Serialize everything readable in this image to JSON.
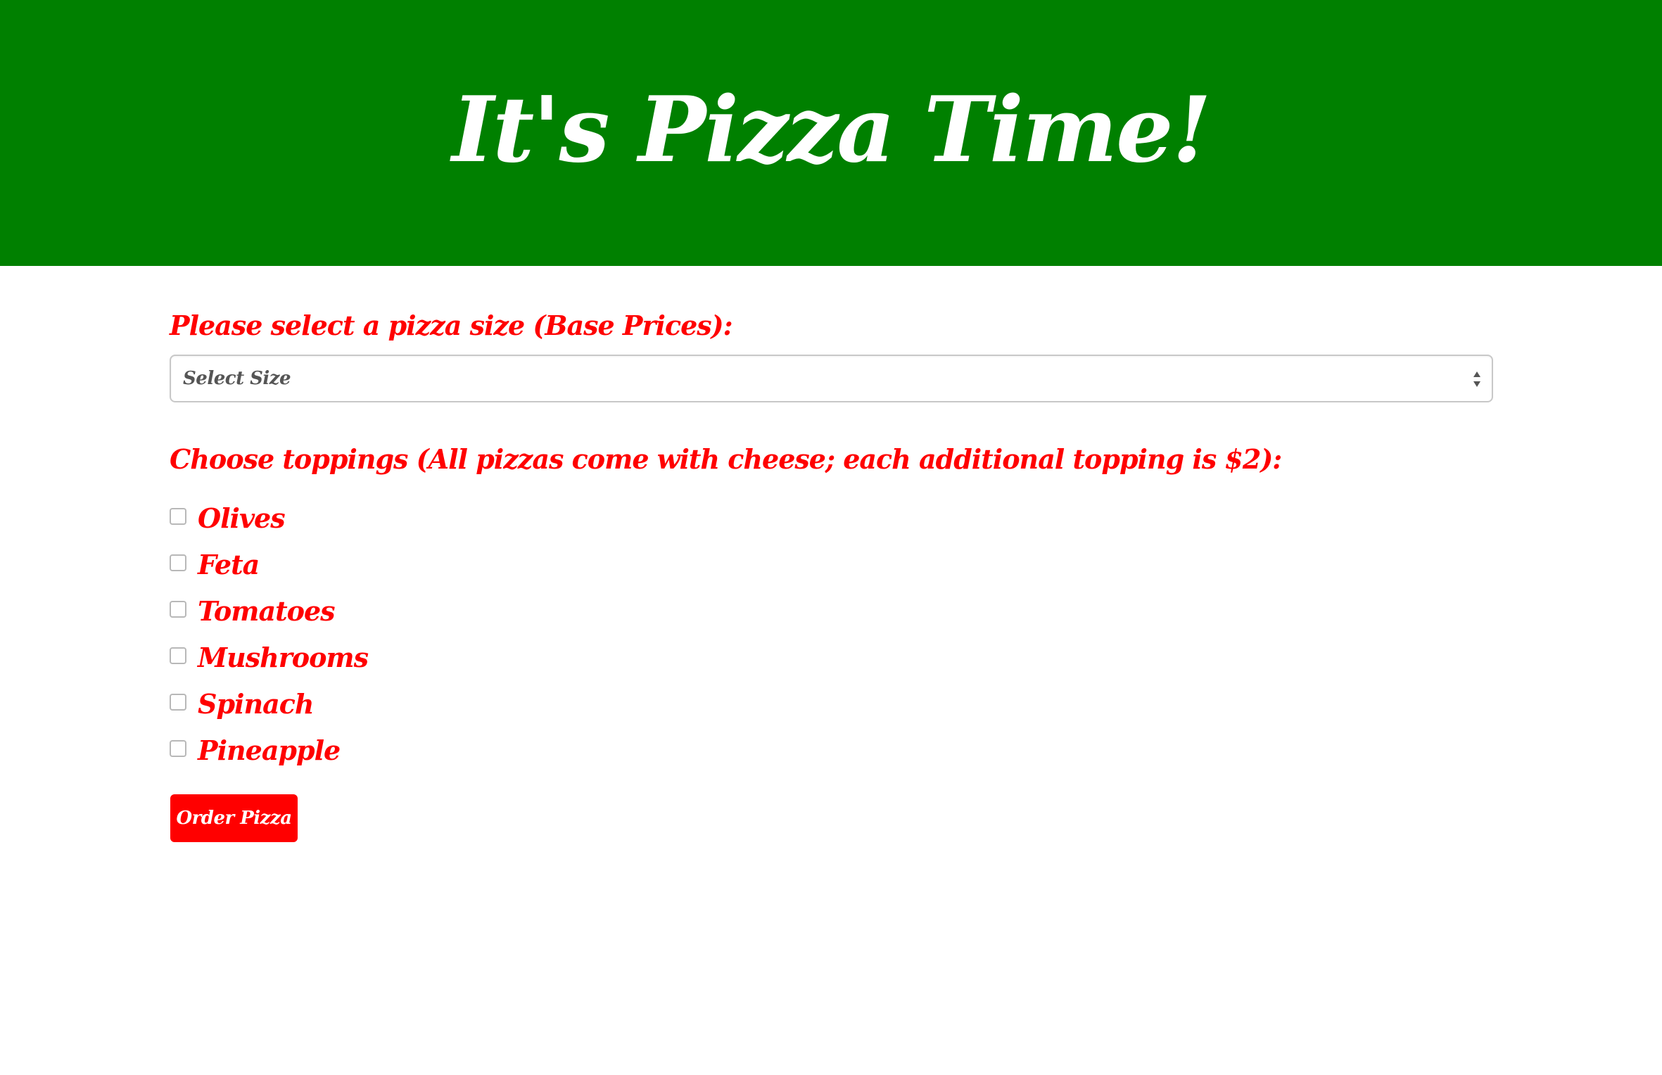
{
  "header": {
    "title": "It's Pizza Time!"
  },
  "size": {
    "label": "Please select a pizza size (Base Prices):",
    "selected": "Select Size"
  },
  "toppings": {
    "label": "Choose toppings (All pizzas come with cheese; each additional topping is $2):",
    "items": [
      {
        "label": "Olives",
        "checked": false
      },
      {
        "label": "Feta",
        "checked": false
      },
      {
        "label": "Tomatoes",
        "checked": false
      },
      {
        "label": "Mushrooms",
        "checked": false
      },
      {
        "label": "Spinach",
        "checked": false
      },
      {
        "label": "Pineapple",
        "checked": false
      }
    ]
  },
  "order": {
    "button_label": "Order Pizza"
  },
  "colors": {
    "header_background": "#008000",
    "accent": "#ff0000",
    "header_text": "#ffffff"
  }
}
